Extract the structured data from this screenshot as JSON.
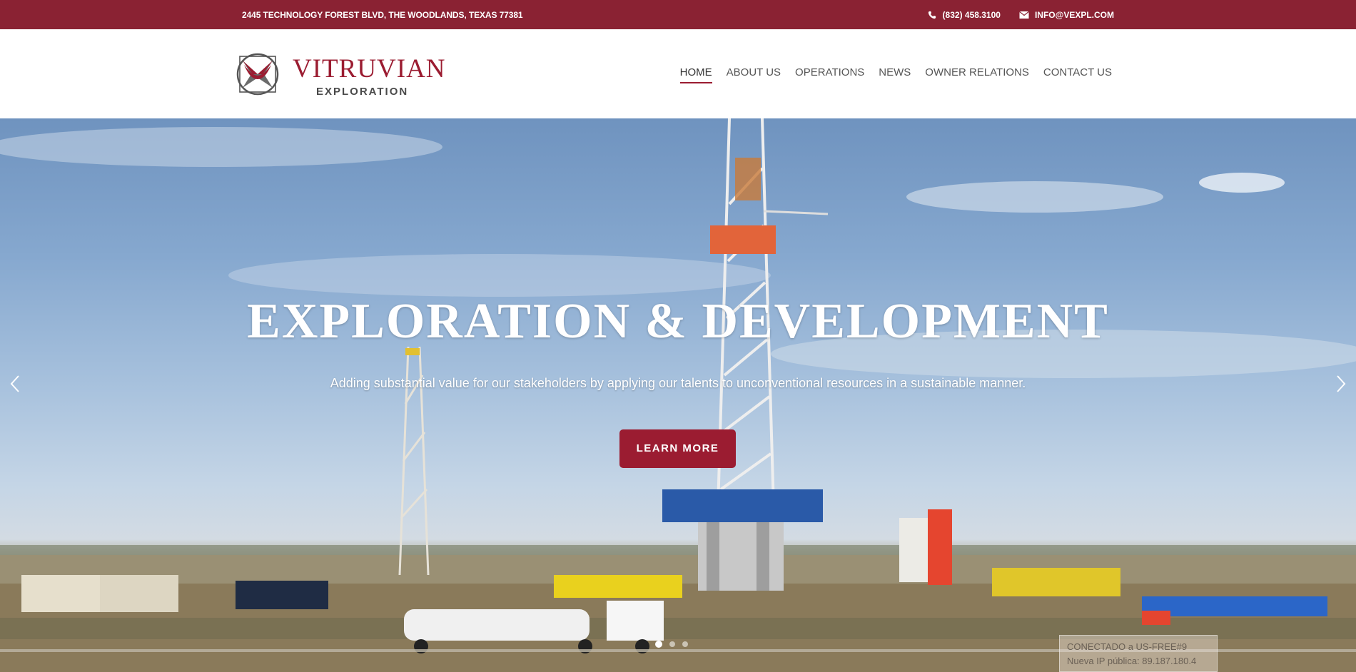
{
  "topbar": {
    "address": "2445 TECHNOLOGY FOREST BLVD, THE WOODLANDS, TEXAS 77381",
    "phone": "(832) 458.3100",
    "email": "INFO@VEXPL.COM",
    "phone_icon": "phone-icon",
    "email_icon": "envelope-icon",
    "background": "#8a2233"
  },
  "logo": {
    "main": "VITRUVIAN",
    "sub": "EXPLORATION",
    "brand_color": "#9b1c31"
  },
  "nav": {
    "items": [
      {
        "label": "HOME",
        "active": true
      },
      {
        "label": "ABOUT US",
        "active": false
      },
      {
        "label": "OPERATIONS",
        "active": false
      },
      {
        "label": "NEWS",
        "active": false
      },
      {
        "label": "OWNER RELATIONS",
        "active": false
      },
      {
        "label": "CONTACT US",
        "active": false
      }
    ]
  },
  "hero": {
    "title": "EXPLORATION & DEVELOPMENT",
    "subtitle": "Adding substantial value for our stakeholders by applying our talents to unconventional resources in a sustainable manner.",
    "cta": "LEARN MORE",
    "prev_icon": "chevron-left-icon",
    "next_icon": "chevron-right-icon",
    "slides": 3,
    "active_slide": 1
  },
  "toast": {
    "line1": "CONECTADO a US-FREE#9",
    "line2": "Nueva IP pública: 89.187.180.4"
  }
}
